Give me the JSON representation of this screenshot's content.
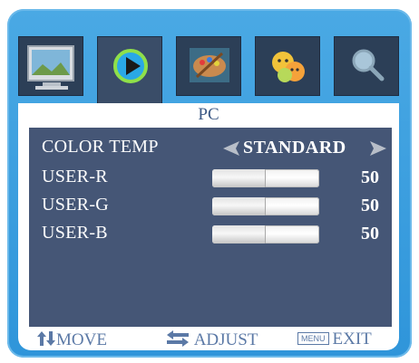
{
  "tabs": [
    {
      "name": "picture",
      "icon": "monitor-landscape-icon",
      "active": false
    },
    {
      "name": "play",
      "icon": "play-icon",
      "active": true
    },
    {
      "name": "palette",
      "icon": "paint-palette-icon",
      "active": false
    },
    {
      "name": "faces",
      "icon": "faces-icon",
      "active": false
    },
    {
      "name": "search",
      "icon": "magnifier-icon",
      "active": false
    }
  ],
  "panel": {
    "title": "PC"
  },
  "color_temp": {
    "label": "COLOR TEMP",
    "value": "STANDARD"
  },
  "sliders": [
    {
      "label": "USER-R",
      "value": 50
    },
    {
      "label": "USER-G",
      "value": 50
    },
    {
      "label": "USER-B",
      "value": 50
    }
  ],
  "footer": {
    "move_label": "MOVE",
    "adjust_label": "ADJUST",
    "menu_key": "MENU",
    "exit_label": "EXIT"
  },
  "colors": {
    "frame": "#2f95da",
    "content": "#455676",
    "title": "#3d5a86",
    "footer_text": "#5b79a6"
  }
}
